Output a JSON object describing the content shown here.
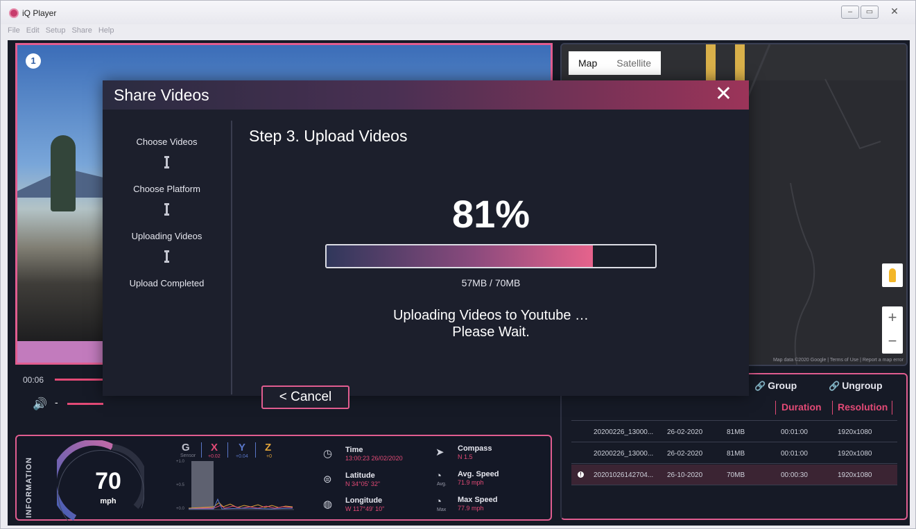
{
  "window": {
    "title": "iQ Player",
    "controls": [
      "–",
      "▭",
      "✕"
    ]
  },
  "menu": [
    "File",
    "Edit",
    "Setup",
    "Share",
    "Help"
  ],
  "video": {
    "camera_badge": "1",
    "timecode": "00:06",
    "volume_icon": "speaker-icon",
    "volume_dash": "-"
  },
  "map": {
    "tabs": [
      "Map",
      "Satellite"
    ],
    "active_tab": "Map",
    "zoom_in": "+",
    "zoom_out": "−",
    "credit": "Map data ©2020 Google | Terms of Use | Report a map error"
  },
  "file_list": {
    "group_label": "Group",
    "ungroup_label": "Ungroup",
    "columns": [
      "Duration",
      "Resolution"
    ],
    "rows": [
      {
        "name": "20200226_13000...",
        "date": "26-02-2020",
        "size": "81MB",
        "duration": "00:01:00",
        "resolution": "1920x1080",
        "selected": false
      },
      {
        "name": "20200226_13000...",
        "date": "26-02-2020",
        "size": "81MB",
        "duration": "00:01:00",
        "resolution": "1920x1080",
        "selected": false
      },
      {
        "name": "20201026142704...",
        "date": "26-10-2020",
        "size": "70MB",
        "duration": "00:00:30",
        "resolution": "1920x1080",
        "selected": true
      }
    ]
  },
  "information": {
    "label": "INFORMATION",
    "speed": "70",
    "speed_unit": "mph",
    "gsensor": {
      "label": "G",
      "sub": "Sensor",
      "axes": [
        {
          "name": "X",
          "value": "+0.02",
          "color": "#e34a76"
        },
        {
          "name": "Y",
          "value": "+0.04",
          "color": "#5a77c9"
        },
        {
          "name": "Z",
          "value": "+0",
          "color": "#e0a33a"
        }
      ],
      "y_ticks": [
        "+1.0",
        "+0.5",
        "+0.0"
      ]
    },
    "time": {
      "label": "Time",
      "value": "13:00:23  26/02/2020"
    },
    "latitude": {
      "label": "Latitude",
      "value": "N 34°05' 32\""
    },
    "longitude": {
      "label": "Longitude",
      "value": "W 117°49' 10\""
    },
    "compass": {
      "label": "Compass",
      "value": "N  1.5"
    },
    "avg_speed": {
      "label": "Avg. Speed",
      "value": "71.9 mph",
      "icon_sub": "Avg."
    },
    "max_speed": {
      "label": "Max Speed",
      "value": "77.9 mph",
      "icon_sub": "Max"
    }
  },
  "modal": {
    "title": "Share Videos",
    "close": "✕",
    "steps": [
      "Choose Videos",
      "Choose Platform",
      "Uploading Videos",
      "Upload Completed"
    ],
    "step_title": "Step 3. Upload Videos",
    "percent_text": "81%",
    "progress": 0.81,
    "sizes": "57MB / 70MB",
    "message_line1": "Uploading Videos to Youtube …",
    "message_line2": "Please Wait.",
    "cancel": "< Cancel"
  },
  "colors": {
    "accent": "#e34a76",
    "background": "#161a26",
    "modal": "#1c1f2c"
  }
}
